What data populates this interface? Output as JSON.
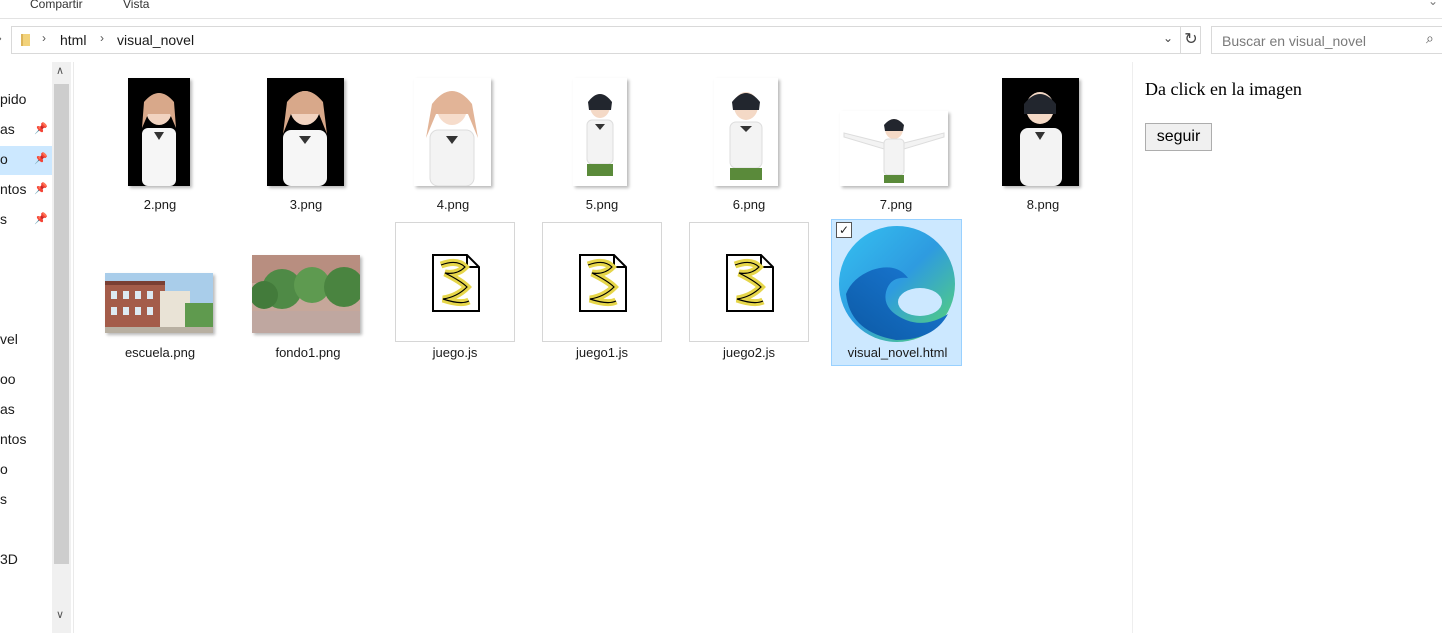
{
  "ribbon": {
    "tabs": [
      "Compartir",
      "Vista"
    ]
  },
  "address": {
    "crumbs": [
      "html",
      "visual_novel"
    ]
  },
  "search": {
    "placeholder": "Buscar en visual_novel"
  },
  "nav": {
    "items": [
      {
        "label": "pido",
        "pinned": false,
        "selected": true
      },
      {
        "label": "as",
        "pinned": true
      },
      {
        "label": "o",
        "pinned": true
      },
      {
        "label": "ntos",
        "pinned": true
      },
      {
        "label": "s",
        "pinned": true
      },
      {
        "label": "vel"
      },
      {
        "label": "oo"
      },
      {
        "label": "as"
      },
      {
        "label": "ntos"
      },
      {
        "label": "o"
      },
      {
        "label": "s"
      },
      {
        "label": "3D"
      }
    ]
  },
  "files": [
    {
      "name": "2.png",
      "kind": "sprite"
    },
    {
      "name": "3.png",
      "kind": "sprite"
    },
    {
      "name": "4.png",
      "kind": "sprite"
    },
    {
      "name": "5.png",
      "kind": "sprite"
    },
    {
      "name": "6.png",
      "kind": "sprite"
    },
    {
      "name": "7.png",
      "kind": "sprite"
    },
    {
      "name": "8.png",
      "kind": "sprite"
    },
    {
      "name": "escuela.png",
      "kind": "background"
    },
    {
      "name": "fondo1.png",
      "kind": "background"
    },
    {
      "name": "juego.js",
      "kind": "script"
    },
    {
      "name": "juego1.js",
      "kind": "script"
    },
    {
      "name": "juego2.js",
      "kind": "script"
    },
    {
      "name": "visual_novel.html",
      "kind": "edge-html",
      "selected": true
    }
  ],
  "preview": {
    "text": "Da click en la imagen",
    "button": "seguir"
  }
}
